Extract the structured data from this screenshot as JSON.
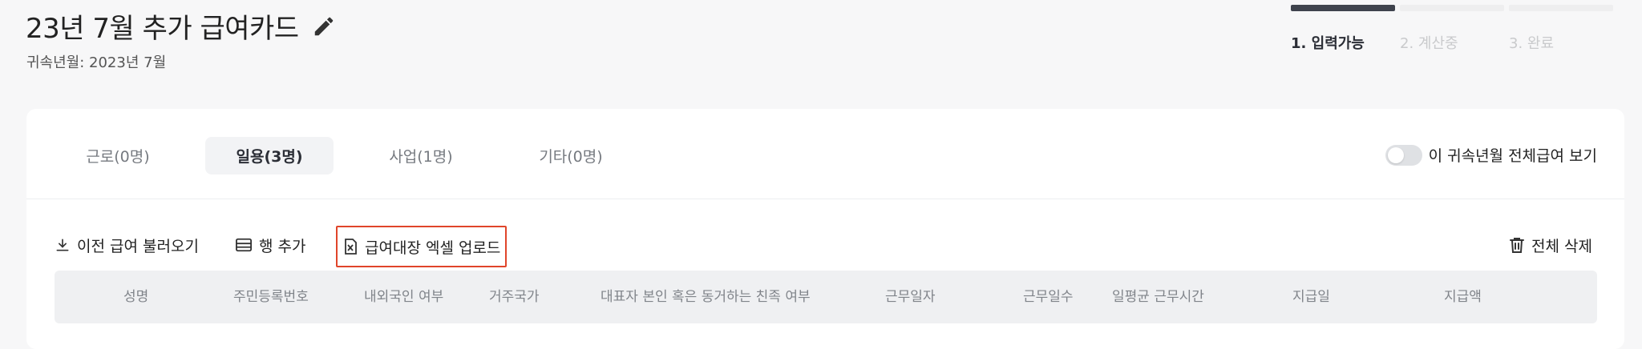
{
  "header": {
    "title": "23년 7월 추가 급여카드",
    "subtitle": "귀속년월: 2023년 7월"
  },
  "steps": [
    {
      "label": "1. 입력가능",
      "active": true
    },
    {
      "label": "2. 계산중",
      "active": false
    },
    {
      "label": "3. 완료",
      "active": false
    }
  ],
  "tabs": [
    {
      "label": "근로(0명)"
    },
    {
      "label": "일용(3명)",
      "active": true
    },
    {
      "label": "사업(1명)"
    },
    {
      "label": "기타(0명)"
    }
  ],
  "toggle": {
    "label": "이 귀속년월 전체급여 보기",
    "on": false
  },
  "toolbar": {
    "import_label": "이전 급여 불러오기",
    "add_row_label": "행 추가",
    "upload_label": "급여대장 엑셀 업로드",
    "delete_all_label": "전체 삭제"
  },
  "table": {
    "columns": [
      "성명",
      "주민등록번호",
      "내외국인 여부",
      "거주국가",
      "대표자 본인 혹은 동거하는 친족 여부",
      "근무일자",
      "근무일수",
      "일평균 근무시간",
      "지급일",
      "지급액"
    ]
  },
  "colors": {
    "accent": "#3f434d",
    "highlight": "#e0452a"
  }
}
